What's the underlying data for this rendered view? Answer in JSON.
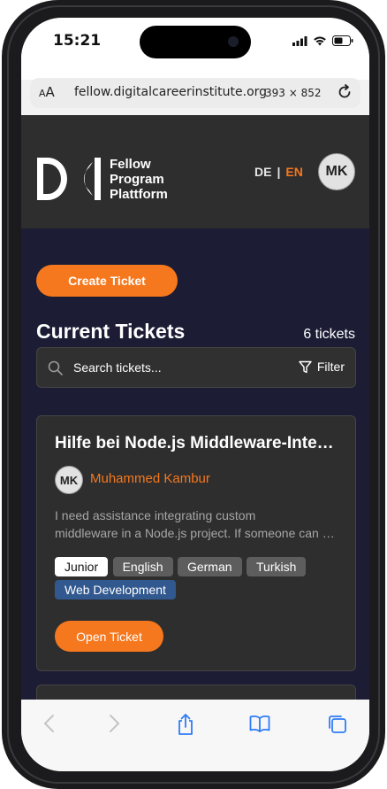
{
  "status_bar": {
    "time": "15:21"
  },
  "browser": {
    "text_size_label": "AA",
    "url": "fellow.digitalcareerinstitute.org",
    "viewport_size": "393 × 852"
  },
  "header": {
    "logo_lines": [
      "Fellow",
      "Program",
      "Plattform"
    ],
    "lang_de": "DE",
    "lang_sep": "|",
    "lang_en": "EN",
    "avatar_initials": "MK"
  },
  "main": {
    "create_button": "Create Ticket",
    "section_title": "Current Tickets",
    "ticket_count": "6 tickets",
    "search_placeholder": "Search tickets...",
    "filter_label": "Filter"
  },
  "tickets": [
    {
      "title": "Hilfe bei Node.js Middleware-Integration",
      "author_initials": "MK",
      "author_name": "Muhammed Kambur",
      "description_lines": [
        "I need assistance integrating custom",
        "middleware in a Node.js project. If someone can help"
      ],
      "level": "Junior",
      "languages": [
        "English",
        "German",
        "Turkish"
      ],
      "category": "Web Development",
      "open_button": "Open Ticket"
    }
  ],
  "colors": {
    "accent": "#f6781e",
    "page_bg": "#1c1d35",
    "card_bg": "#2e2e2e",
    "category_tag": "#31588f"
  },
  "toolbar_icons": [
    "back-icon",
    "forward-icon",
    "share-icon",
    "bookmarks-icon",
    "tabs-icon"
  ]
}
